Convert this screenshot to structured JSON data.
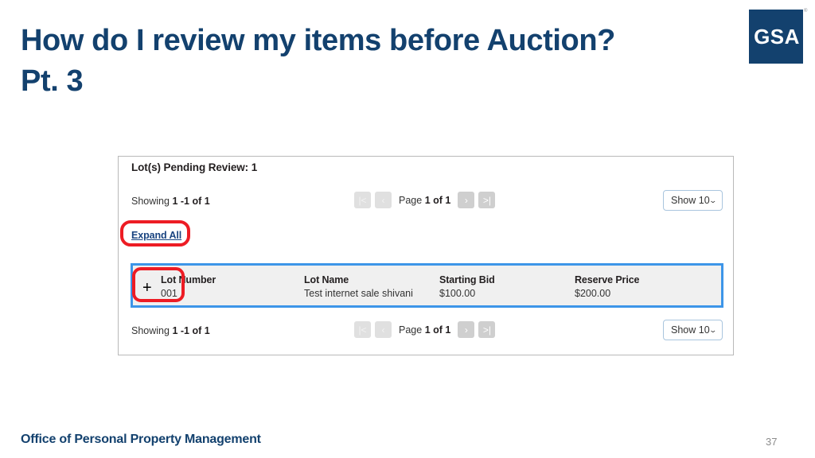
{
  "slide": {
    "title": "How do I review my items before Auction? Pt. 3",
    "number": "37",
    "footer": "Office of Personal Property Management",
    "brand_navy": "#13416e",
    "annotation_red": "#ed1c24",
    "row_highlight_blue": "#3d95e8"
  },
  "logo": {
    "text": "GSA",
    "trademark": "®"
  },
  "panel": {
    "heading": "Lot(s) Pending Review: 1",
    "expand_all_label": "Expand All",
    "pager_top": {
      "showing_prefix": "Showing",
      "showing_range": "1 -1",
      "showing_of": "of",
      "showing_total": "1",
      "page_prefix": "Page",
      "page_current": "1",
      "page_of": "of",
      "page_total": "1",
      "first_icon": "|<",
      "prev_icon": "‹",
      "next_icon": "›",
      "last_icon": ">|",
      "show_select_value": "Show 10",
      "show_select_caret": "⌄"
    },
    "pager_bottom": {
      "showing_prefix": "Showing",
      "showing_range": "1 -1",
      "showing_of": "of",
      "showing_total": "1",
      "page_prefix": "Page",
      "page_current": "1",
      "page_of": "of",
      "page_total": "1",
      "first_icon": "|<",
      "prev_icon": "‹",
      "next_icon": "›",
      "last_icon": ">|",
      "show_select_value": "Show 10",
      "show_select_caret": "⌄"
    },
    "lot_row": {
      "expand_icon": "+",
      "columns": [
        {
          "label": "Lot Number",
          "value": "001"
        },
        {
          "label": "Lot Name",
          "value": "Test internet sale shivani"
        },
        {
          "label": "Starting Bid",
          "value": "$100.00"
        },
        {
          "label": "Reserve Price",
          "value": "$200.00"
        }
      ]
    }
  }
}
